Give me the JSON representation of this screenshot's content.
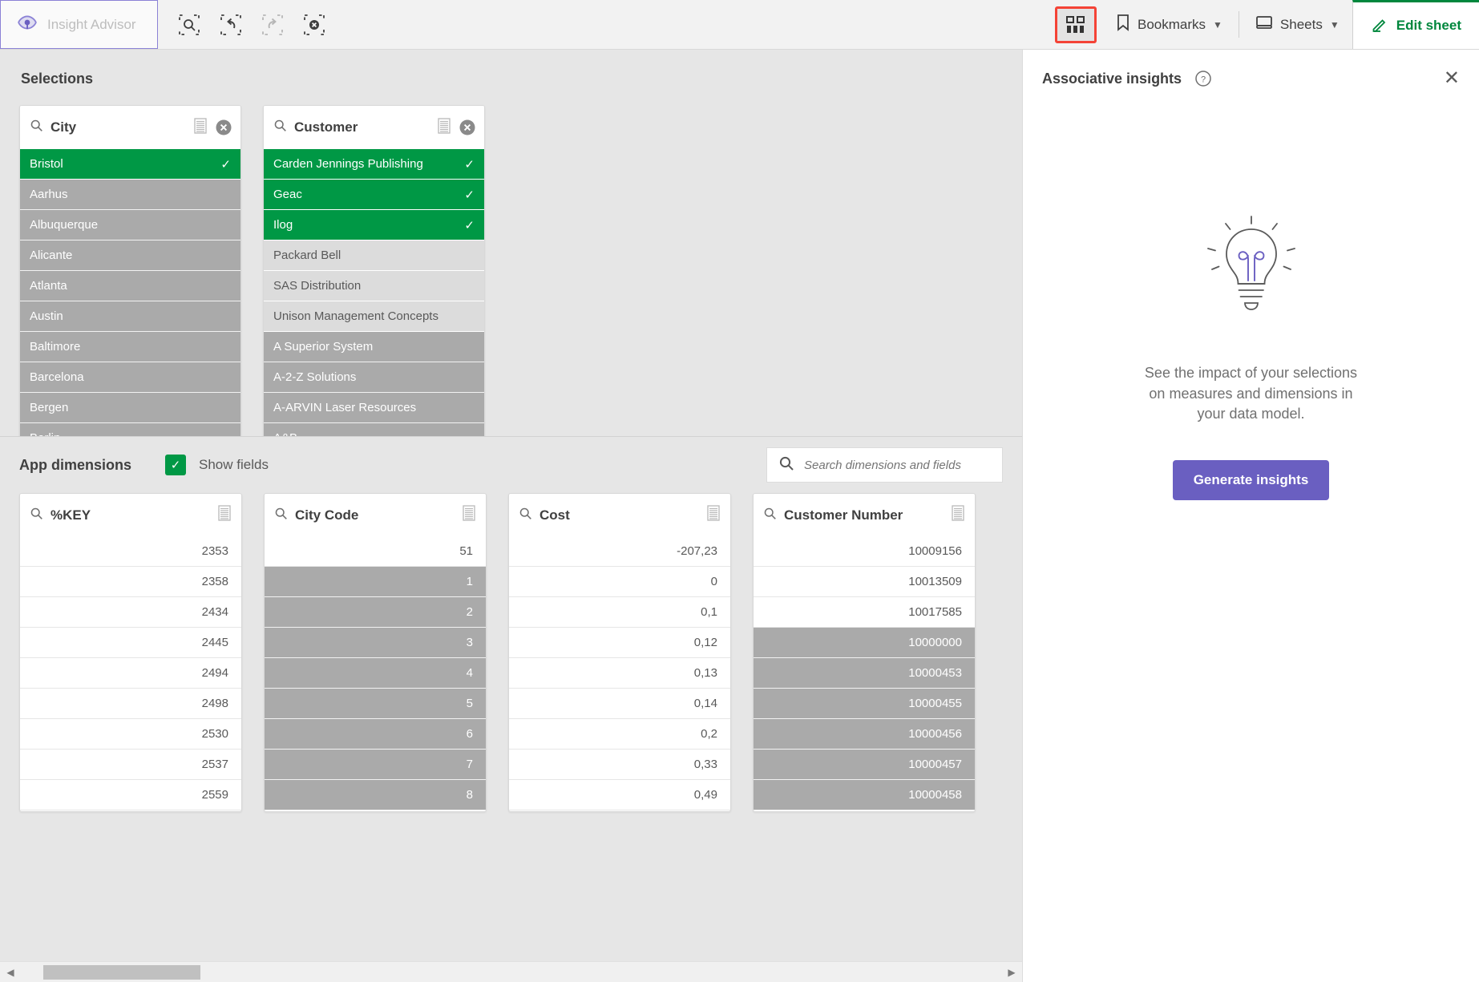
{
  "toolbar": {
    "insight_advisor_label": "Insight Advisor",
    "tools": [
      {
        "name": "selection-search-icon",
        "disabled": false
      },
      {
        "name": "step-back-icon",
        "disabled": false
      },
      {
        "name": "step-forward-icon",
        "disabled": true
      },
      {
        "name": "clear-all-selections-icon",
        "disabled": false
      }
    ],
    "associative_insights_toggle": "chart-grid-icon",
    "bookmarks_label": "Bookmarks",
    "sheets_label": "Sheets",
    "edit_sheet_label": "Edit sheet",
    "accent_green": "#00873d",
    "highlight_red": "#f44336"
  },
  "selections": {
    "title": "Selections",
    "listboxes": [
      {
        "field": "City",
        "items": [
          {
            "label": "Bristol",
            "state": "selected"
          },
          {
            "label": "Aarhus",
            "state": "excluded"
          },
          {
            "label": "Albuquerque",
            "state": "excluded"
          },
          {
            "label": "Alicante",
            "state": "excluded"
          },
          {
            "label": "Atlanta",
            "state": "excluded"
          },
          {
            "label": "Austin",
            "state": "excluded"
          },
          {
            "label": "Baltimore",
            "state": "excluded"
          },
          {
            "label": "Barcelona",
            "state": "excluded"
          },
          {
            "label": "Bergen",
            "state": "excluded"
          },
          {
            "label": "Berlin",
            "state": "excluded"
          }
        ]
      },
      {
        "field": "Customer",
        "items": [
          {
            "label": "Carden Jennings Publishing",
            "state": "selected"
          },
          {
            "label": "Geac",
            "state": "selected"
          },
          {
            "label": "Ilog",
            "state": "selected"
          },
          {
            "label": "Packard Bell",
            "state": "alternative"
          },
          {
            "label": "SAS Distribution",
            "state": "alternative"
          },
          {
            "label": "Unison Management Concepts",
            "state": "alternative"
          },
          {
            "label": "A Superior System",
            "state": "excluded"
          },
          {
            "label": "A-2-Z Solutions",
            "state": "excluded"
          },
          {
            "label": "A-ARVIN Laser Resources",
            "state": "excluded"
          },
          {
            "label": "A&B",
            "state": "excluded"
          }
        ]
      }
    ]
  },
  "app_dimensions": {
    "title": "App dimensions",
    "show_fields_label": "Show fields",
    "show_fields_checked": true,
    "search": {
      "placeholder": "Search dimensions and fields",
      "value": ""
    },
    "fields": [
      {
        "name": "%KEY",
        "rows": [
          {
            "value": "2353",
            "state": "normal"
          },
          {
            "value": "2358",
            "state": "normal"
          },
          {
            "value": "2434",
            "state": "normal"
          },
          {
            "value": "2445",
            "state": "normal"
          },
          {
            "value": "2494",
            "state": "normal"
          },
          {
            "value": "2498",
            "state": "normal"
          },
          {
            "value": "2530",
            "state": "normal"
          },
          {
            "value": "2537",
            "state": "normal"
          },
          {
            "value": "2559",
            "state": "normal"
          }
        ]
      },
      {
        "name": "City Code",
        "rows": [
          {
            "value": "51",
            "state": "normal"
          },
          {
            "value": "1",
            "state": "excluded"
          },
          {
            "value": "2",
            "state": "excluded"
          },
          {
            "value": "3",
            "state": "excluded"
          },
          {
            "value": "4",
            "state": "excluded"
          },
          {
            "value": "5",
            "state": "excluded"
          },
          {
            "value": "6",
            "state": "excluded"
          },
          {
            "value": "7",
            "state": "excluded"
          },
          {
            "value": "8",
            "state": "excluded"
          }
        ]
      },
      {
        "name": "Cost",
        "rows": [
          {
            "value": "-207,23",
            "state": "normal"
          },
          {
            "value": "0",
            "state": "normal"
          },
          {
            "value": "0,1",
            "state": "normal"
          },
          {
            "value": "0,12",
            "state": "normal"
          },
          {
            "value": "0,13",
            "state": "normal"
          },
          {
            "value": "0,14",
            "state": "normal"
          },
          {
            "value": "0,2",
            "state": "normal"
          },
          {
            "value": "0,33",
            "state": "normal"
          },
          {
            "value": "0,49",
            "state": "normal"
          }
        ]
      },
      {
        "name": "Customer Number",
        "rows": [
          {
            "value": "10009156",
            "state": "normal"
          },
          {
            "value": "10013509",
            "state": "normal"
          },
          {
            "value": "10017585",
            "state": "normal"
          },
          {
            "value": "10000000",
            "state": "excluded"
          },
          {
            "value": "10000453",
            "state": "excluded"
          },
          {
            "value": "10000455",
            "state": "excluded"
          },
          {
            "value": "10000456",
            "state": "excluded"
          },
          {
            "value": "10000457",
            "state": "excluded"
          },
          {
            "value": "10000458",
            "state": "excluded"
          }
        ]
      }
    ]
  },
  "associative_insights": {
    "title": "Associative insights",
    "description": "See the impact of your selections on measures and dimensions in your data model.",
    "button_label": "Generate insights",
    "button_color": "#6a5fc1",
    "illustration": "lightbulb-icon"
  }
}
